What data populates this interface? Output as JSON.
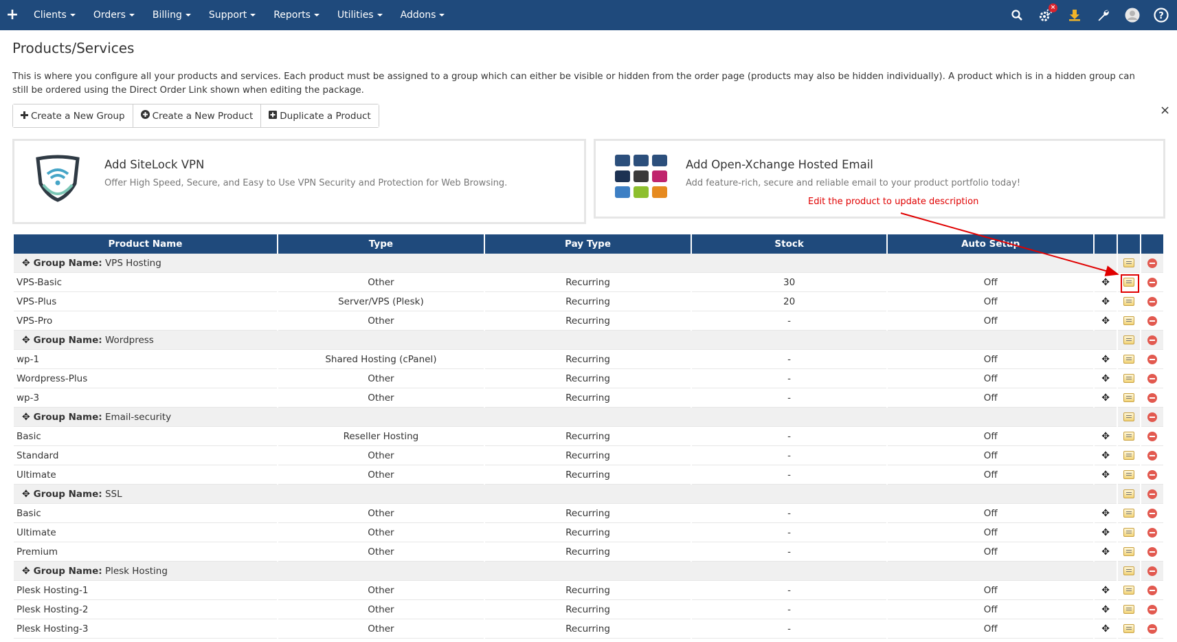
{
  "nav": {
    "menu": [
      {
        "label": "Clients",
        "name": "nav-clients"
      },
      {
        "label": "Orders",
        "name": "nav-orders"
      },
      {
        "label": "Billing",
        "name": "nav-billing"
      },
      {
        "label": "Support",
        "name": "nav-support"
      },
      {
        "label": "Reports",
        "name": "nav-reports"
      },
      {
        "label": "Utilities",
        "name": "nav-utilities"
      },
      {
        "label": "Addons",
        "name": "nav-addons"
      }
    ],
    "plus_glyph": "+",
    "notification_badge": "×",
    "icons": [
      "search-icon",
      "gear-icon",
      "download-icon",
      "wrench-icon",
      "user-avatar-icon",
      "help-icon"
    ]
  },
  "page": {
    "title": "Products/Services",
    "intro": "This is where you configure all your products and services. Each product must be assigned to a group which can either be visible or hidden from the order page (products may also be hidden individually). A product which is in a hidden group can still be ordered using the Direct Order Link shown when editing the package.",
    "buttons": {
      "new_group": "Create a New Group",
      "new_product": "Create a New Product",
      "duplicate": "Duplicate a Product"
    },
    "dismiss": "×"
  },
  "promos": {
    "sitelock": {
      "title": "Add SiteLock VPN",
      "desc": "Offer High Speed, Secure, and Easy to Use VPN Security and Protection for Web Browsing."
    },
    "oxmail": {
      "title": "Add Open-Xchange Hosted Email",
      "desc": "Add feature-rich, secure and reliable email to your product portfolio today!",
      "tile_colors": [
        "#2c4f7c",
        "#2c4f7c",
        "#2c4f7c",
        "#1c3152",
        "#3a3a3a",
        "#c0246d",
        "#3d7fc4",
        "#8dbf2e",
        "#e68a1f"
      ]
    }
  },
  "annotation": "Edit the product to update description",
  "table": {
    "headers": {
      "name": "Product Name",
      "type": "Type",
      "pay": "Pay Type",
      "stock": "Stock",
      "auto": "Auto Setup"
    },
    "group_prefix": "Group Name:",
    "groups": [
      {
        "name": "VPS Hosting",
        "products": [
          {
            "name": "VPS-Basic",
            "type": "Other",
            "pay": "Recurring",
            "stock": "30",
            "auto": "Off"
          },
          {
            "name": "VPS-Plus",
            "type": "Server/VPS (Plesk)",
            "pay": "Recurring",
            "stock": "20",
            "auto": "Off"
          },
          {
            "name": "VPS-Pro",
            "type": "Other",
            "pay": "Recurring",
            "stock": "-",
            "auto": "Off"
          }
        ]
      },
      {
        "name": "Wordpress",
        "products": [
          {
            "name": "wp-1",
            "type": "Shared Hosting (cPanel)",
            "pay": "Recurring",
            "stock": "-",
            "auto": "Off"
          },
          {
            "name": "Wordpress-Plus",
            "type": "Other",
            "pay": "Recurring",
            "stock": "-",
            "auto": "Off"
          },
          {
            "name": "wp-3",
            "type": "Other",
            "pay": "Recurring",
            "stock": "-",
            "auto": "Off"
          }
        ]
      },
      {
        "name": "Email-security",
        "products": [
          {
            "name": "Basic",
            "type": "Reseller Hosting",
            "pay": "Recurring",
            "stock": "-",
            "auto": "Off"
          },
          {
            "name": "Standard",
            "type": "Other",
            "pay": "Recurring",
            "stock": "-",
            "auto": "Off"
          },
          {
            "name": "Ultimate",
            "type": "Other",
            "pay": "Recurring",
            "stock": "-",
            "auto": "Off"
          }
        ]
      },
      {
        "name": "SSL",
        "products": [
          {
            "name": "Basic",
            "type": "Other",
            "pay": "Recurring",
            "stock": "-",
            "auto": "Off"
          },
          {
            "name": "Ultimate",
            "type": "Other",
            "pay": "Recurring",
            "stock": "-",
            "auto": "Off"
          },
          {
            "name": "Premium",
            "type": "Other",
            "pay": "Recurring",
            "stock": "-",
            "auto": "Off"
          }
        ]
      },
      {
        "name": "Plesk Hosting",
        "products": [
          {
            "name": "Plesk Hosting-1",
            "type": "Other",
            "pay": "Recurring",
            "stock": "-",
            "auto": "Off"
          },
          {
            "name": "Plesk Hosting-2",
            "type": "Other",
            "pay": "Recurring",
            "stock": "-",
            "auto": "Off"
          },
          {
            "name": "Plesk Hosting-3",
            "type": "Other",
            "pay": "Recurring",
            "stock": "-",
            "auto": "Off"
          }
        ]
      }
    ]
  }
}
